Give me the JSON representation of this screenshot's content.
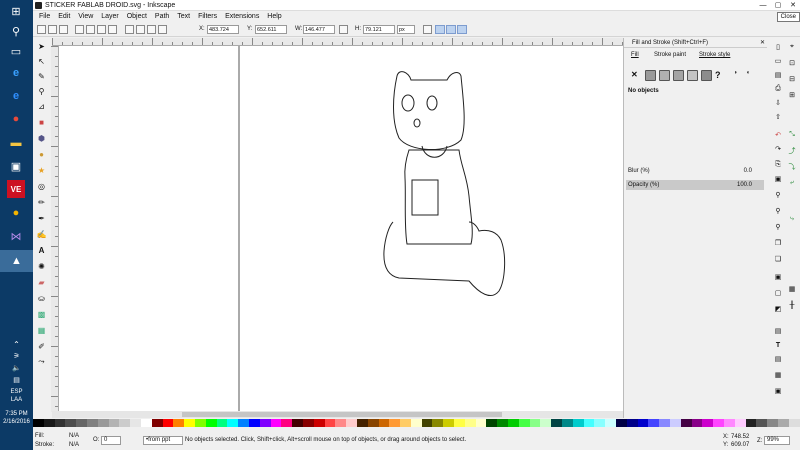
{
  "window": {
    "title": "STICKER FABLAB DROID.svg - Inkscape",
    "close_tooltip": "Close",
    "controls": [
      "minimize-icon",
      "maximize-icon",
      "close-icon"
    ]
  },
  "menu": [
    "File",
    "Edit",
    "View",
    "Layer",
    "Object",
    "Path",
    "Text",
    "Filters",
    "Extensions",
    "Help"
  ],
  "toolbar": {
    "x_label": "X:",
    "x_value": "483.724",
    "y_label": "Y:",
    "y_value": "652.611",
    "w_label": "W:",
    "w_value": "146.477",
    "h_label": "H:",
    "h_value": "79.121",
    "units": "px"
  },
  "dock": {
    "title": "Fill and Stroke (Shift+Ctrl+F)",
    "tabs": [
      "Fill",
      "Stroke paint",
      "Stroke style"
    ],
    "selection_status": "No objects",
    "blur_label": "Blur (%)",
    "blur_value": "0.0",
    "opacity_label": "Opacity (%)",
    "opacity_value": "100.0"
  },
  "statusbar": {
    "fill_label": "Fill:",
    "fill_value": "N/A",
    "stroke_label": "Stroke:",
    "stroke_value": "N/A",
    "o_label": "O:",
    "o_value": "0",
    "layer": "•from ppt",
    "message": "No objects selected. Click, Shift+click, Alt+scroll mouse on top of objects, or drag around objects to select.",
    "x_label": "X:",
    "x_value": "748.52",
    "y_label": "Y:",
    "y_value": "609.07",
    "zoom_label": "Z:",
    "zoom_value": "99%"
  },
  "taskbar": {
    "time": "7:35 PM",
    "date": "2/16/2016",
    "lang1": "ESP",
    "lang2": "LAA"
  },
  "colors": {
    "taskbar": "#0c3a66",
    "accent": "#1e7fd6"
  }
}
